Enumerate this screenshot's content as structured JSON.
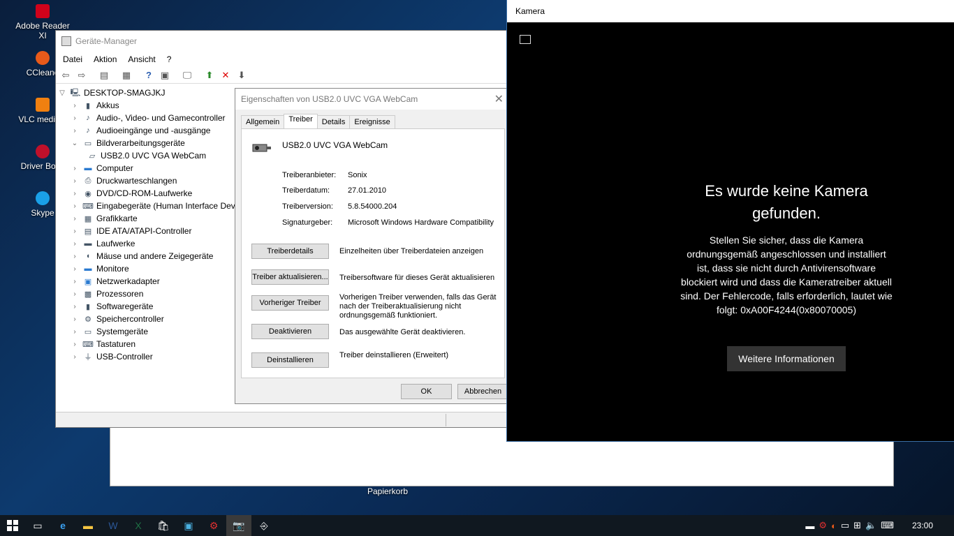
{
  "desktop": {
    "icons": [
      {
        "label": "Adobe Reader XI",
        "color": "#d0021b"
      },
      {
        "label": "CCleane",
        "color": "#e85a1a"
      },
      {
        "label": "VLC media p",
        "color": "#f08010"
      },
      {
        "label": "Driver Boos",
        "color": "#c0102a"
      },
      {
        "label": "Skype",
        "color": "#1aa0e8"
      }
    ],
    "recycle_bin": "Papierkorb"
  },
  "device_manager": {
    "title": "Geräte-Manager",
    "menu": [
      "Datei",
      "Aktion",
      "Ansicht",
      "?"
    ],
    "tree": {
      "root": "DESKTOP-SMAGJKJ",
      "items": [
        {
          "label": "Akkus"
        },
        {
          "label": "Audio-, Video- und Gamecontroller"
        },
        {
          "label": "Audioeingänge und -ausgänge"
        },
        {
          "label": "Bildverarbeitungsgeräte"
        },
        {
          "label": "USB2.0 UVC VGA WebCam"
        },
        {
          "label": "Computer"
        },
        {
          "label": "Druckwarteschlangen"
        },
        {
          "label": "DVD/CD-ROM-Laufwerke"
        },
        {
          "label": "Eingabegeräte (Human Interface Dev"
        },
        {
          "label": "Grafikkarte"
        },
        {
          "label": "IDE ATA/ATAPI-Controller"
        },
        {
          "label": "Laufwerke"
        },
        {
          "label": "Mäuse und andere Zeigegeräte"
        },
        {
          "label": "Monitore"
        },
        {
          "label": "Netzwerkadapter"
        },
        {
          "label": "Prozessoren"
        },
        {
          "label": "Softwaregeräte"
        },
        {
          "label": "Speichercontroller"
        },
        {
          "label": "Systemgeräte"
        },
        {
          "label": "Tastaturen"
        },
        {
          "label": "USB-Controller"
        }
      ]
    }
  },
  "properties": {
    "title": "Eigenschaften von USB2.0 UVC VGA WebCam",
    "tabs": [
      "Allgemein",
      "Treiber",
      "Details",
      "Ereignisse"
    ],
    "device_name": "USB2.0 UVC VGA WebCam",
    "fields": [
      {
        "key": "Treiberanbieter:",
        "value": "Sonix"
      },
      {
        "key": "Treiberdatum:",
        "value": "27.01.2010"
      },
      {
        "key": "Treiberversion:",
        "value": "5.8.54000.204"
      },
      {
        "key": "Signaturgeber:",
        "value": "Microsoft Windows Hardware Compatibility"
      }
    ],
    "buttons": [
      {
        "label": "Treiberdetails",
        "desc": "Einzelheiten über Treiberdateien anzeigen"
      },
      {
        "label": "Treiber aktualisieren...",
        "desc": "Treibersoftware für dieses Gerät aktualisieren"
      },
      {
        "label": "Vorheriger Treiber",
        "desc": "Vorherigen Treiber verwenden, falls das Gerät nach der Treiberaktualisierung nicht ordnungsgemäß funktioniert."
      },
      {
        "label": "Deaktivieren",
        "desc": "Das ausgewählte Gerät deaktivieren."
      },
      {
        "label": "Deinstallieren",
        "desc": "Treiber deinstallieren (Erweitert)"
      }
    ],
    "ok": "OK",
    "cancel": "Abbrechen"
  },
  "camera": {
    "title": "Kamera",
    "heading": "Es wurde keine Kamera gefunden.",
    "body": "Stellen Sie sicher, dass die Kamera ordnungsgemäß angeschlossen und installiert ist, dass sie nicht durch Antivirensoftware blockiert wird und dass die Kameratreiber aktuell sind. Der Fehlercode, falls erforderlich, lautet wie folgt: 0xA00F4244(0x80070005)",
    "button": "Weitere Informationen"
  },
  "taskbar": {
    "clock": "23:00"
  }
}
